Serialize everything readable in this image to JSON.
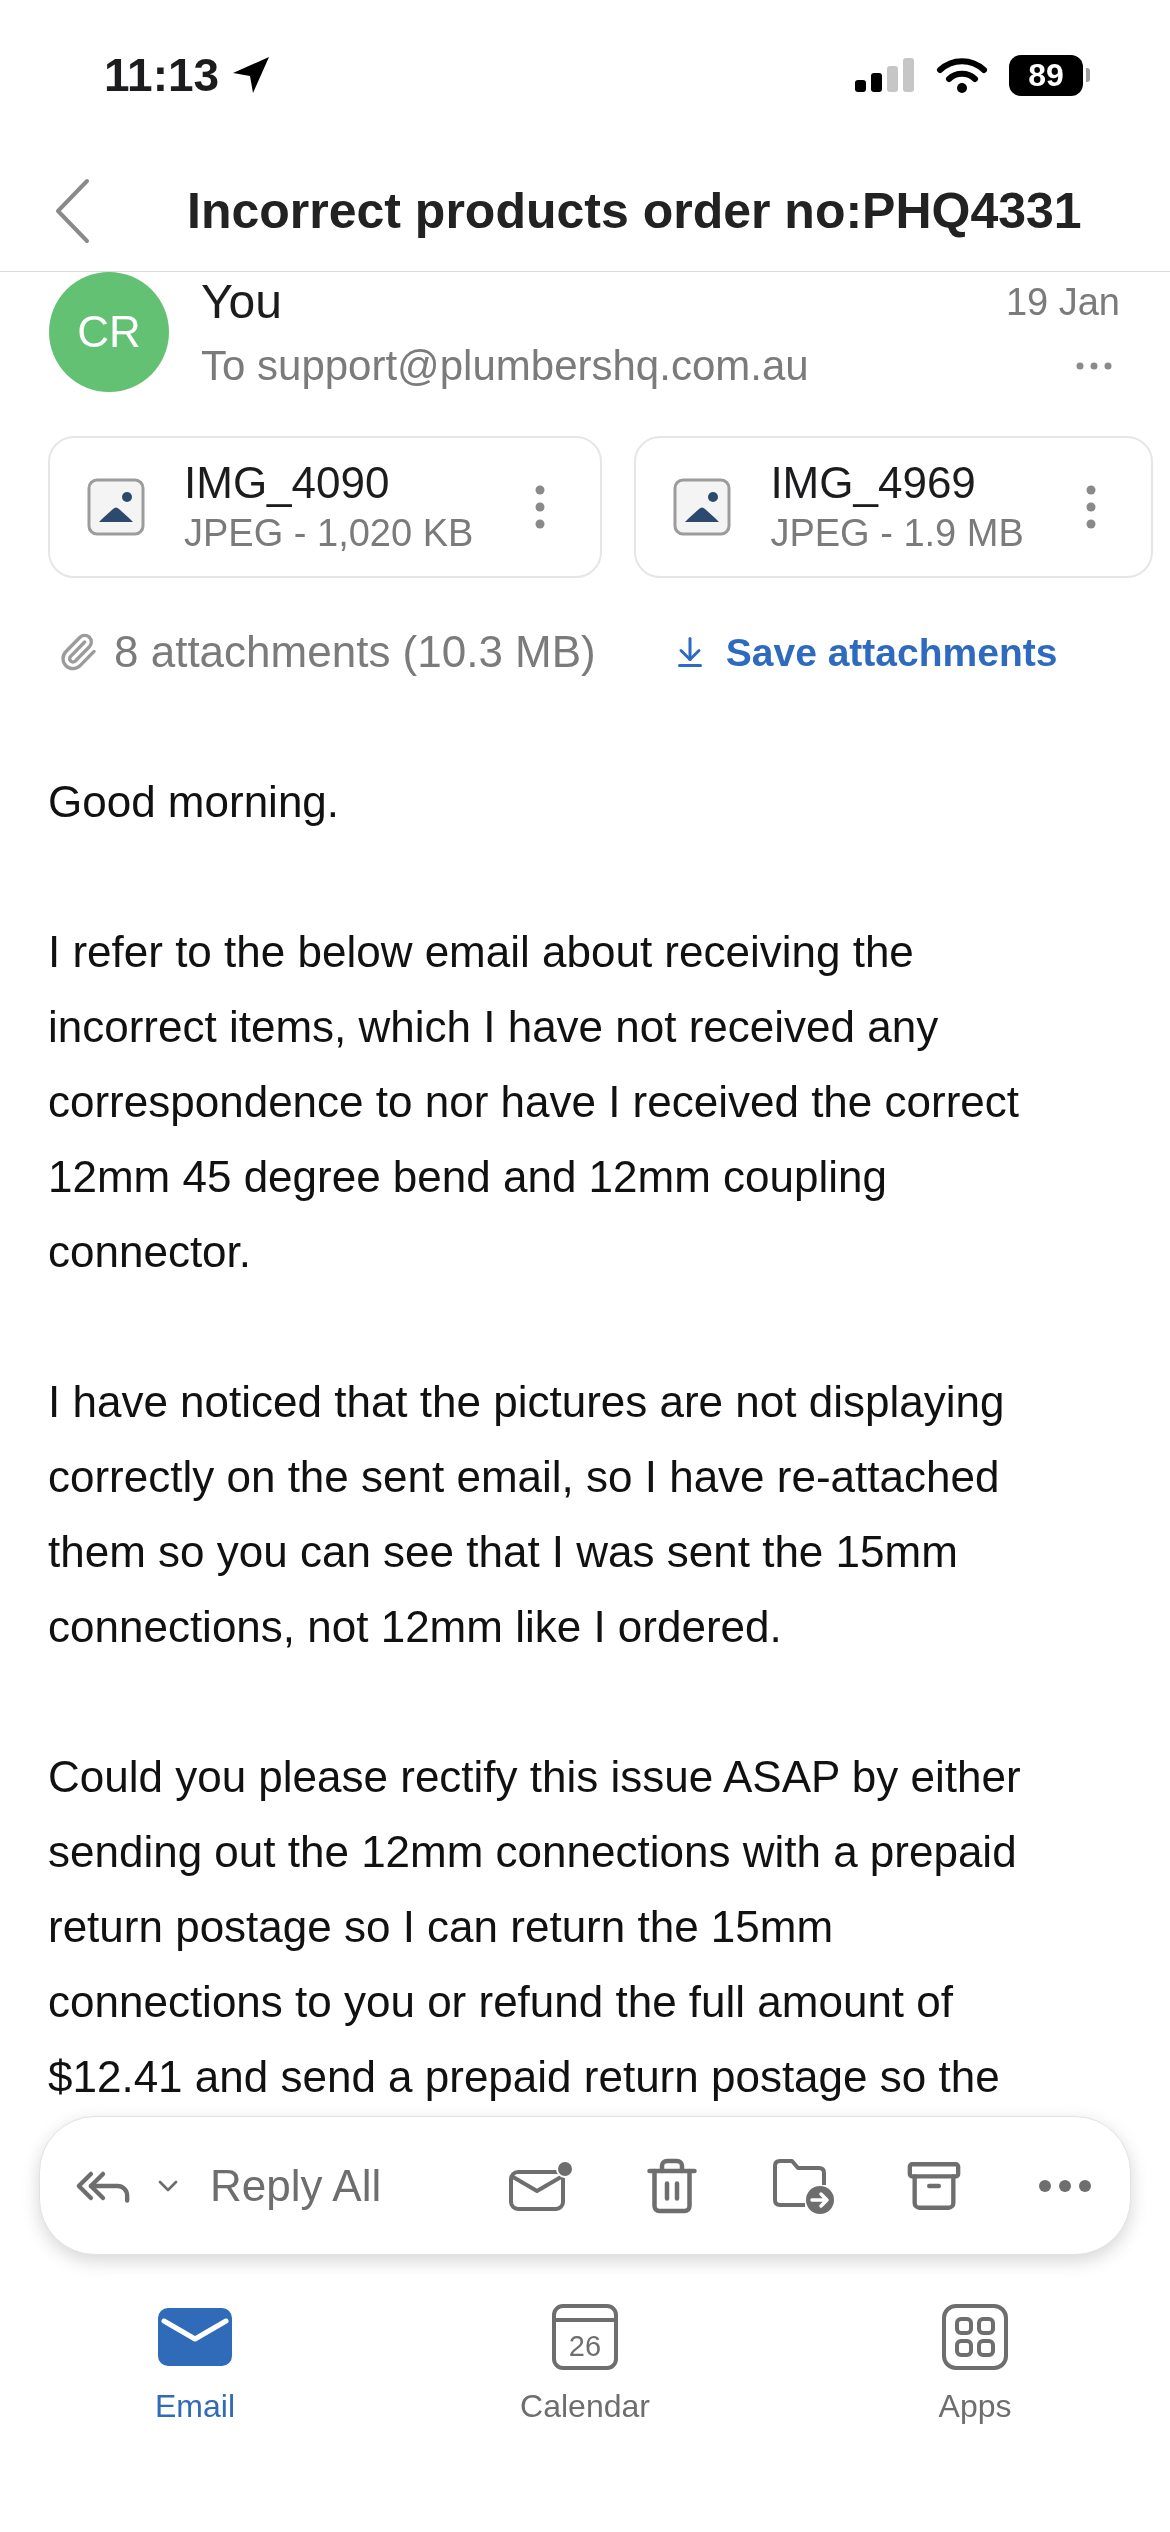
{
  "status_bar": {
    "time": "11:13",
    "battery": "89"
  },
  "header": {
    "title": "Incorrect products order no:PHQ4331"
  },
  "message": {
    "avatar": "CR",
    "sender": "You",
    "date": "19 Jan",
    "recipients": "To support@plumbershq.com.au"
  },
  "attachments": [
    {
      "name": "IMG_4090",
      "details": "JPEG - 1,020 KB"
    },
    {
      "name": "IMG_4969",
      "details": "JPEG - 1.9 MB"
    }
  ],
  "attachment_summary": {
    "count": "8 attachments (10.3 MB)",
    "save": "Save attachments"
  },
  "body": [
    "Good morning.",
    "I refer to the below email about receiving the incorrect items, which I have not received any correspondence to nor have I received the correct 12mm 45 degree bend and 12mm coupling connector.",
    "I have noticed that the pictures are not displaying correctly on the sent email, so I have re-attached them so you can see that I was sent the 15mm connections, not 12mm like I ordered.",
    "Could you please rectify this issue ASAP by either sending out the 12mm connections with a prepaid return postage so I can return the 15mm connections to you or refund the full amount of $12.41 and send a prepaid return postage so the"
  ],
  "toolbar": {
    "reply": "Reply All"
  },
  "tabs": [
    {
      "kind": "email",
      "label": "Email",
      "selected": true
    },
    {
      "kind": "calendar",
      "label": "Calendar",
      "icon_text": "26",
      "selected": false
    },
    {
      "kind": "apps",
      "label": "Apps",
      "selected": false
    }
  ]
}
